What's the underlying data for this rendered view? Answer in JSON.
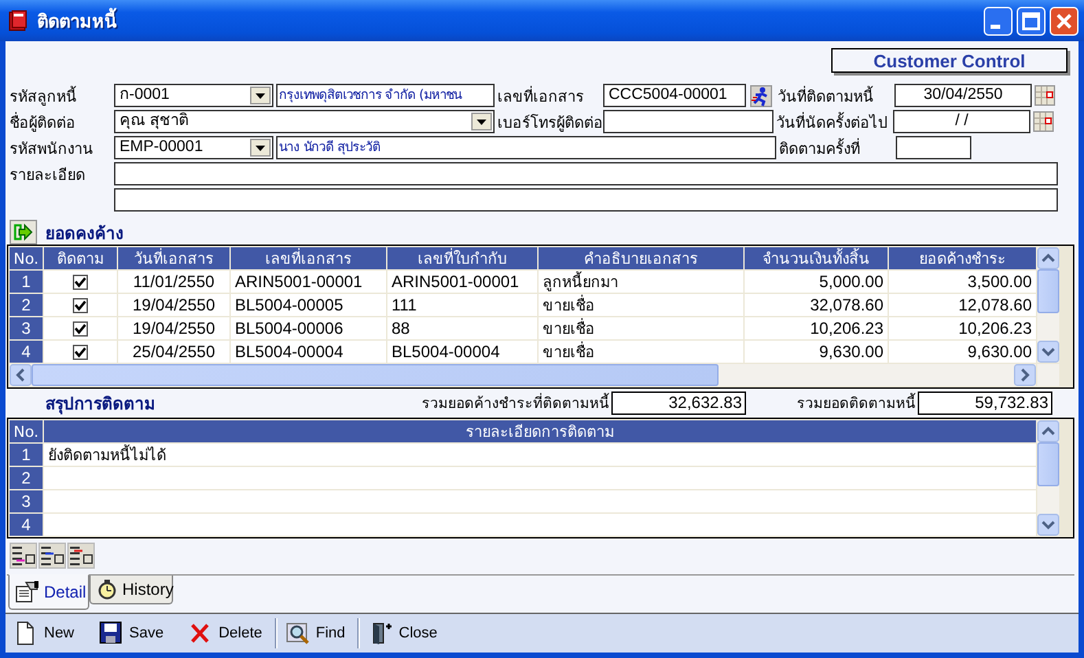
{
  "window": {
    "title": "ติดตามหนี้"
  },
  "customer_control_button": "Customer Control",
  "form": {
    "debtor": {
      "label": "รหัสลูกหนี้",
      "code": "ก-0001",
      "name": "กรุงเทพดุสิตเวชการ จำกัด (มหาชน"
    },
    "document_no": {
      "label": "เลขที่เอกสาร",
      "value": "CCC5004-00001"
    },
    "follow_date": {
      "label": "วันที่ติดตามหนี้",
      "value": "30/04/2550"
    },
    "contact": {
      "label": "ชื่อผู้ติดต่อ",
      "value": "คุณ สุชาติ"
    },
    "phone": {
      "label": "เบอร์โทรผู้ติดต่อ"
    },
    "next_date": {
      "label": "วันที่นัดครั้งต่อไป",
      "value": "/ /"
    },
    "employee": {
      "label": "รหัสพนักงาน",
      "code": "EMP-00001",
      "name": "นาง นักวดี สุประวัติ"
    },
    "follow_count": {
      "label": "ติดตามครั้งที่"
    },
    "detail": {
      "label": "รายละเอียด"
    }
  },
  "outstanding": {
    "title": "ยอดคงค้าง",
    "columns": [
      "No.",
      "ติดตาม",
      "วันที่เอกสาร",
      "เลขที่เอกสาร",
      "เลขที่ใบกำกับ",
      "คำอธิบายเอกสาร",
      "จำนวนเงินทั้งสิ้น",
      "ยอดค้างชำระ"
    ],
    "rows": [
      {
        "no": "1",
        "checked": true,
        "date": "11/01/2550",
        "document_no": "ARIN5001-00001",
        "invoice_no": "ARIN5001-00001",
        "description": "ลูกหนี้ยกมา",
        "amount": "5,000.00",
        "outstanding": "3,500.00"
      },
      {
        "no": "2",
        "checked": true,
        "date": "19/04/2550",
        "document_no": "BL5004-00005",
        "invoice_no": "111",
        "description": "ขายเชื่อ",
        "amount": "32,078.60",
        "outstanding": "12,078.60"
      },
      {
        "no": "3",
        "checked": true,
        "date": "19/04/2550",
        "document_no": "BL5004-00006",
        "invoice_no": "88",
        "description": "ขายเชื่อ",
        "amount": "10,206.23",
        "outstanding": "10,206.23"
      },
      {
        "no": "4",
        "checked": true,
        "date": "25/04/2550",
        "document_no": "BL5004-00004",
        "invoice_no": "BL5004-00004",
        "description": "ขายเชื่อ",
        "amount": "9,630.00",
        "outstanding": "9,630.00"
      }
    ]
  },
  "summary": {
    "title": "สรุปการติดตาม",
    "totals": [
      {
        "label": "รวมยอดค้างชำระที่ติดตามหนี้",
        "value": "32,632.83"
      },
      {
        "label": "รวมยอดติดตามหนี้",
        "value": "59,732.83"
      }
    ],
    "columns": [
      "No.",
      "รายละเอียดการติดตาม"
    ],
    "rows": [
      {
        "no": "1",
        "detail": "ยังติดตามหนี้ไม่ได้"
      },
      {
        "no": "2"
      },
      {
        "no": "3"
      },
      {
        "no": "4"
      }
    ]
  },
  "tabs": [
    {
      "label": "Detail",
      "selected": true
    },
    {
      "label": "History",
      "selected": false
    }
  ],
  "toolbar": [
    {
      "kind": "new",
      "label": "New",
      "separator": false
    },
    {
      "kind": "save",
      "label": "Save",
      "separator": false
    },
    {
      "kind": "delete",
      "label": "Delete",
      "separator": false
    },
    {
      "kind": "find",
      "label": "Find",
      "separator": true
    },
    {
      "kind": "close",
      "label": "Close",
      "separator": true
    }
  ]
}
